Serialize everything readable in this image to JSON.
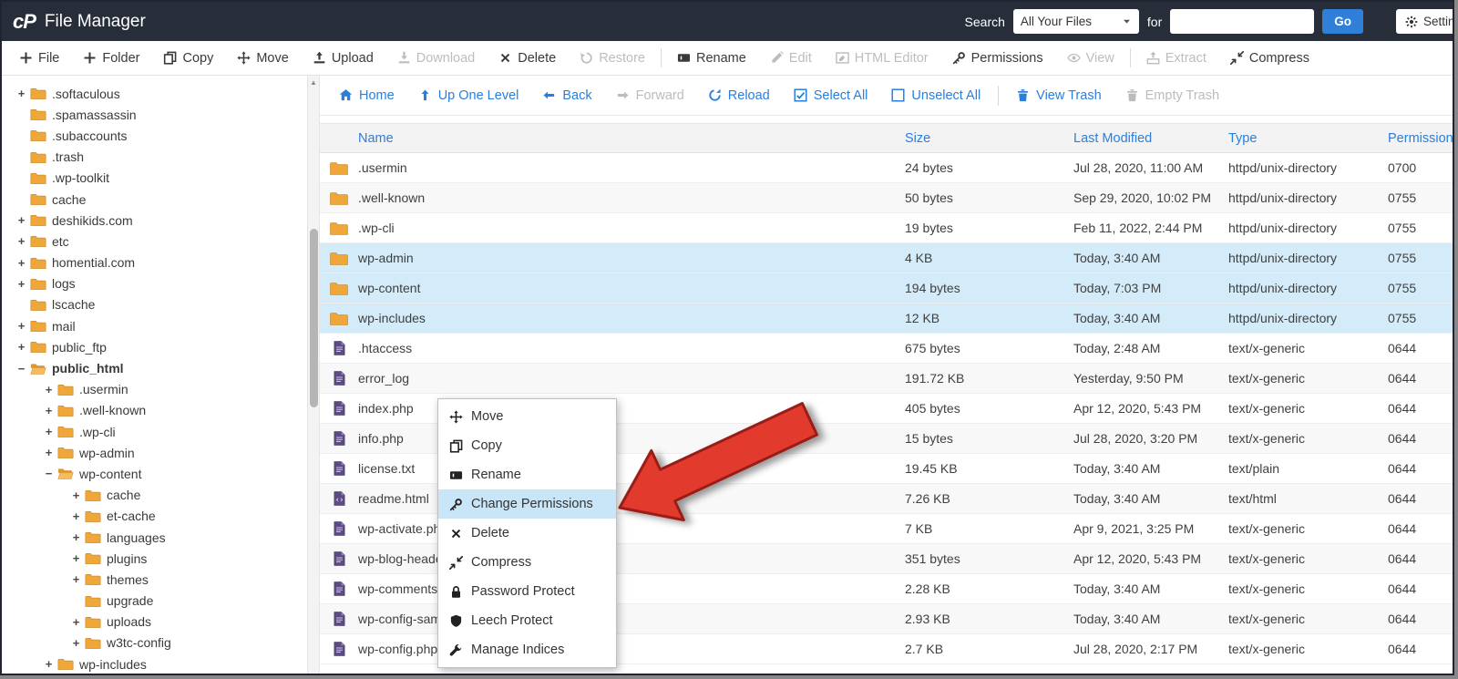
{
  "header": {
    "logo": "cP",
    "title": "File Manager",
    "search_label": "Search",
    "search_scope_value": "All Your Files",
    "for_label": "for",
    "search_value": "",
    "go_label": "Go",
    "settings_label": "Settings"
  },
  "toolbar": [
    {
      "label": "File",
      "icon": "plus",
      "enabled": true
    },
    {
      "label": "Folder",
      "icon": "plus",
      "enabled": true
    },
    {
      "label": "Copy",
      "icon": "copy",
      "enabled": true
    },
    {
      "label": "Move",
      "icon": "move",
      "enabled": true
    },
    {
      "label": "Upload",
      "icon": "upload",
      "enabled": true
    },
    {
      "label": "Download",
      "icon": "download",
      "enabled": false
    },
    {
      "label": "Delete",
      "icon": "xmark",
      "enabled": true
    },
    {
      "label": "Restore",
      "icon": "restore",
      "enabled": false,
      "divider_after": true
    },
    {
      "label": "Rename",
      "icon": "rename",
      "enabled": true
    },
    {
      "label": "Edit",
      "icon": "pencil",
      "enabled": false
    },
    {
      "label": "HTML Editor",
      "icon": "htmledit",
      "enabled": false
    },
    {
      "label": "Permissions",
      "icon": "key",
      "enabled": true
    },
    {
      "label": "View",
      "icon": "eye",
      "enabled": false,
      "divider_after": true
    },
    {
      "label": "Extract",
      "icon": "extract",
      "enabled": false
    },
    {
      "label": "Compress",
      "icon": "compress",
      "enabled": true
    }
  ],
  "tree": [
    {
      "name": ".softaculous",
      "level": 0,
      "expander": "+"
    },
    {
      "name": ".spamassassin",
      "level": 0,
      "expander": ""
    },
    {
      "name": ".subaccounts",
      "level": 0,
      "expander": ""
    },
    {
      "name": ".trash",
      "level": 0,
      "expander": ""
    },
    {
      "name": ".wp-toolkit",
      "level": 0,
      "expander": ""
    },
    {
      "name": "cache",
      "level": 0,
      "expander": ""
    },
    {
      "name": "deshikids.com",
      "level": 0,
      "expander": "+"
    },
    {
      "name": "etc",
      "level": 0,
      "expander": "+"
    },
    {
      "name": "homential.com",
      "level": 0,
      "expander": "+"
    },
    {
      "name": "logs",
      "level": 0,
      "expander": "+"
    },
    {
      "name": "lscache",
      "level": 0,
      "expander": ""
    },
    {
      "name": "mail",
      "level": 0,
      "expander": "+"
    },
    {
      "name": "public_ftp",
      "level": 0,
      "expander": "+"
    },
    {
      "name": "public_html",
      "level": 0,
      "expander": "−",
      "open": true,
      "bold": true
    },
    {
      "name": ".usermin",
      "level": 1,
      "expander": "+"
    },
    {
      "name": ".well-known",
      "level": 1,
      "expander": "+"
    },
    {
      "name": ".wp-cli",
      "level": 1,
      "expander": "+"
    },
    {
      "name": "wp-admin",
      "level": 1,
      "expander": "+"
    },
    {
      "name": "wp-content",
      "level": 1,
      "expander": "−",
      "open": true
    },
    {
      "name": "cache",
      "level": 2,
      "expander": "+"
    },
    {
      "name": "et-cache",
      "level": 2,
      "expander": "+"
    },
    {
      "name": "languages",
      "level": 2,
      "expander": "+"
    },
    {
      "name": "plugins",
      "level": 2,
      "expander": "+"
    },
    {
      "name": "themes",
      "level": 2,
      "expander": "+"
    },
    {
      "name": "upgrade",
      "level": 2,
      "expander": ""
    },
    {
      "name": "uploads",
      "level": 2,
      "expander": "+"
    },
    {
      "name": "w3tc-config",
      "level": 2,
      "expander": "+"
    },
    {
      "name": "wp-includes",
      "level": 1,
      "expander": "+"
    }
  ],
  "nav": [
    {
      "label": "Home",
      "icon": "home",
      "enabled": true
    },
    {
      "label": "Up One Level",
      "icon": "up",
      "enabled": true
    },
    {
      "label": "Back",
      "icon": "left",
      "enabled": true
    },
    {
      "label": "Forward",
      "icon": "right",
      "enabled": false
    },
    {
      "label": "Reload",
      "icon": "reload",
      "enabled": true
    },
    {
      "label": "Select All",
      "icon": "checksq",
      "enabled": true
    },
    {
      "label": "Unselect All",
      "icon": "square",
      "enabled": true,
      "divider_after": true
    },
    {
      "label": "View Trash",
      "icon": "trash",
      "enabled": true
    },
    {
      "label": "Empty Trash",
      "icon": "trash",
      "enabled": false
    }
  ],
  "table": {
    "columns": [
      "Name",
      "Size",
      "Last Modified",
      "Type",
      "Permissions"
    ],
    "rows": [
      {
        "name": ".usermin",
        "kind": "folder",
        "size": "24 bytes",
        "modified": "Jul 28, 2020, 11:00 AM",
        "type": "httpd/unix-directory",
        "perms": "0700",
        "selected": false
      },
      {
        "name": ".well-known",
        "kind": "folder",
        "size": "50 bytes",
        "modified": "Sep 29, 2020, 10:02 PM",
        "type": "httpd/unix-directory",
        "perms": "0755",
        "selected": false
      },
      {
        "name": ".wp-cli",
        "kind": "folder",
        "size": "19 bytes",
        "modified": "Feb 11, 2022, 2:44 PM",
        "type": "httpd/unix-directory",
        "perms": "0755",
        "selected": false
      },
      {
        "name": "wp-admin",
        "kind": "folder",
        "size": "4 KB",
        "modified": "Today, 3:40 AM",
        "type": "httpd/unix-directory",
        "perms": "0755",
        "selected": true
      },
      {
        "name": "wp-content",
        "kind": "folder",
        "size": "194 bytes",
        "modified": "Today, 7:03 PM",
        "type": "httpd/unix-directory",
        "perms": "0755",
        "selected": true
      },
      {
        "name": "wp-includes",
        "kind": "folder",
        "size": "12 KB",
        "modified": "Today, 3:40 AM",
        "type": "httpd/unix-directory",
        "perms": "0755",
        "selected": true
      },
      {
        "name": ".htaccess",
        "kind": "file",
        "size": "675 bytes",
        "modified": "Today, 2:48 AM",
        "type": "text/x-generic",
        "perms": "0644",
        "selected": false
      },
      {
        "name": "error_log",
        "kind": "file",
        "size": "191.72 KB",
        "modified": "Yesterday, 9:50 PM",
        "type": "text/x-generic",
        "perms": "0644",
        "selected": false
      },
      {
        "name": "index.php",
        "kind": "file",
        "size": "405 bytes",
        "modified": "Apr 12, 2020, 5:43 PM",
        "type": "text/x-generic",
        "perms": "0644",
        "selected": false
      },
      {
        "name": "info.php",
        "kind": "file",
        "size": "15 bytes",
        "modified": "Jul 28, 2020, 3:20 PM",
        "type": "text/x-generic",
        "perms": "0644",
        "selected": false
      },
      {
        "name": "license.txt",
        "kind": "file",
        "size": "19.45 KB",
        "modified": "Today, 3:40 AM",
        "type": "text/plain",
        "perms": "0644",
        "selected": false
      },
      {
        "name": "readme.html",
        "kind": "filecode",
        "size": "7.26 KB",
        "modified": "Today, 3:40 AM",
        "type": "text/html",
        "perms": "0644",
        "selected": false
      },
      {
        "name": "wp-activate.php",
        "kind": "file",
        "size": "7 KB",
        "modified": "Apr 9, 2021, 3:25 PM",
        "type": "text/x-generic",
        "perms": "0644",
        "selected": false
      },
      {
        "name": "wp-blog-header.php",
        "kind": "file",
        "size": "351 bytes",
        "modified": "Apr 12, 2020, 5:43 PM",
        "type": "text/x-generic",
        "perms": "0644",
        "selected": false
      },
      {
        "name": "wp-comments-post.php",
        "kind": "file",
        "size": "2.28 KB",
        "modified": "Today, 3:40 AM",
        "type": "text/x-generic",
        "perms": "0644",
        "selected": false
      },
      {
        "name": "wp-config-sample.php",
        "kind": "file",
        "size": "2.93 KB",
        "modified": "Today, 3:40 AM",
        "type": "text/x-generic",
        "perms": "0644",
        "selected": false
      },
      {
        "name": "wp-config.php",
        "kind": "file",
        "size": "2.7 KB",
        "modified": "Jul 28, 2020, 2:17 PM",
        "type": "text/x-generic",
        "perms": "0644",
        "selected": false
      }
    ]
  },
  "context_menu": [
    {
      "label": "Move",
      "icon": "move",
      "highlighted": false
    },
    {
      "label": "Copy",
      "icon": "copy",
      "highlighted": false
    },
    {
      "label": "Rename",
      "icon": "rename",
      "highlighted": false
    },
    {
      "label": "Change Permissions",
      "icon": "key",
      "highlighted": true
    },
    {
      "label": "Delete",
      "icon": "xmark",
      "highlighted": false
    },
    {
      "label": "Compress",
      "icon": "compress",
      "highlighted": false
    },
    {
      "label": "Password Protect",
      "icon": "lock",
      "highlighted": false
    },
    {
      "label": "Leech Protect",
      "icon": "shield",
      "highlighted": false
    },
    {
      "label": "Manage Indices",
      "icon": "wrench",
      "highlighted": false
    }
  ],
  "colors": {
    "header_bg": "#272e3a",
    "link_blue": "#2a7ede",
    "selected_row": "#d4ecf9",
    "menu_highlight": "#c9e6f8",
    "folder_icon": "#f0a73a",
    "file_icon": "#5d4b85",
    "go_button": "#2f7ed8",
    "arrow_red": "#e23b2e"
  }
}
